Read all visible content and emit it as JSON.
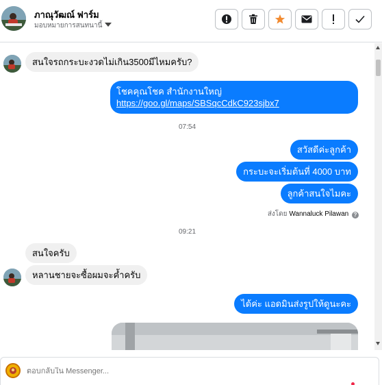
{
  "header": {
    "name": "ภาณุวัฒณ์ ฟาร์ม",
    "assign_label": "มอบหมายการสนทนานี้",
    "actions": [
      {
        "icon": "alert-circle-icon"
      },
      {
        "icon": "trash-icon"
      },
      {
        "icon": "star-icon",
        "color": "#f28b30"
      },
      {
        "icon": "envelope-icon"
      },
      {
        "icon": "exclamation-icon"
      },
      {
        "icon": "check-icon"
      }
    ]
  },
  "messages": [
    {
      "dir": "in",
      "text": "สนใจรถกระบะงวดไม่เกิน3500มีไหมครับ?"
    },
    {
      "dir": "out",
      "line1": "โชคคุณโชค สำนักงานใหญ่",
      "link": "https://goo.gl/maps/SBSqcCdkC923sjbx7"
    },
    {
      "timestamp": "07:54"
    },
    {
      "dir": "out",
      "text": "สวัสดีค่ะลูกค้า"
    },
    {
      "dir": "out",
      "text": "กระบะจะเริ่มต้นที่ 4000  บาท"
    },
    {
      "dir": "out",
      "text": "ลูกค้าสนใจไมคะ"
    },
    {
      "sent_by_prefix": "ส่งโดย",
      "sent_by_name": "Wannaluck Pilawan"
    },
    {
      "timestamp": "09:21"
    },
    {
      "dir": "in",
      "text": "สนใจครับ"
    },
    {
      "dir": "in",
      "text": "หลานชายจะซื้อผมจะค้ำครับ"
    },
    {
      "dir": "out",
      "text": "ได้ค่ะ แอดมินส่งรูปให้ดูนะคะ"
    }
  ],
  "composer": {
    "placeholder": "ตอบกลับใน Messenger..."
  },
  "colors": {
    "outgoing": "#0a7cff",
    "incoming": "#f0f0f0",
    "star": "#f28b30"
  }
}
